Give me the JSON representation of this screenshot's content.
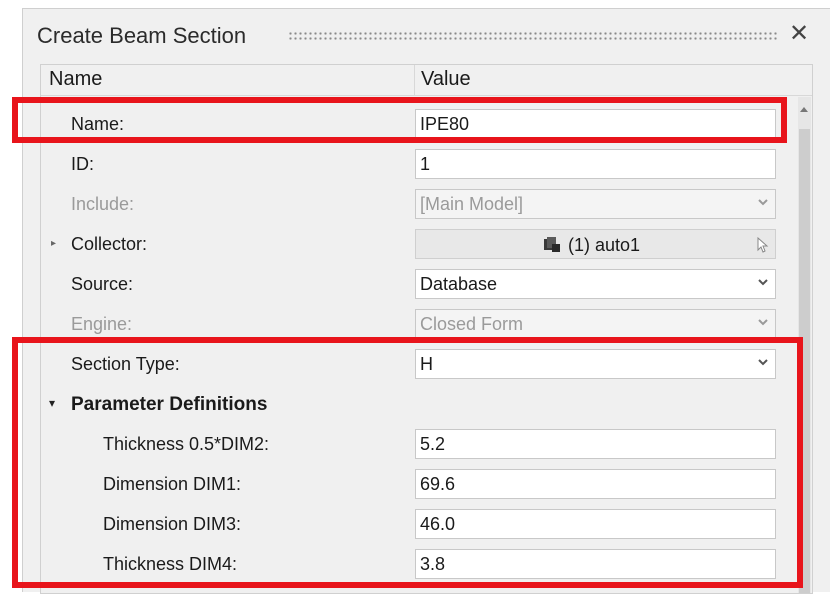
{
  "dialog": {
    "title": "Create Beam Section",
    "close_glyph": "✕"
  },
  "table": {
    "col_name": "Name",
    "col_value": "Value"
  },
  "rows": {
    "name": {
      "label": "Name:",
      "value": "IPE80"
    },
    "id": {
      "label": "ID:",
      "value": "1"
    },
    "include": {
      "label": "Include:",
      "value": "[Main Model]"
    },
    "collector": {
      "label": "Collector:",
      "value": "(1) auto1",
      "icon": "component-collector-icon"
    },
    "source": {
      "label": "Source:",
      "value": "Database"
    },
    "engine": {
      "label": "Engine:",
      "value": "Closed Form"
    },
    "section_type": {
      "label": "Section Type:",
      "value": "H"
    },
    "param_defs": {
      "label": "Parameter Definitions"
    },
    "thickness_half_dim2": {
      "label": "Thickness 0.5*DIM2:",
      "value": "5.2"
    },
    "dim1": {
      "label": "Dimension DIM1:",
      "value": "69.6"
    },
    "dim3": {
      "label": "Dimension DIM3:",
      "value": "46.0"
    },
    "thickness_dim4": {
      "label": "Thickness DIM4:",
      "value": "3.8"
    }
  },
  "colors": {
    "highlight": "#e8141b",
    "panel_bg": "#f0f0f0",
    "disabled_text": "#9a9a9a"
  }
}
